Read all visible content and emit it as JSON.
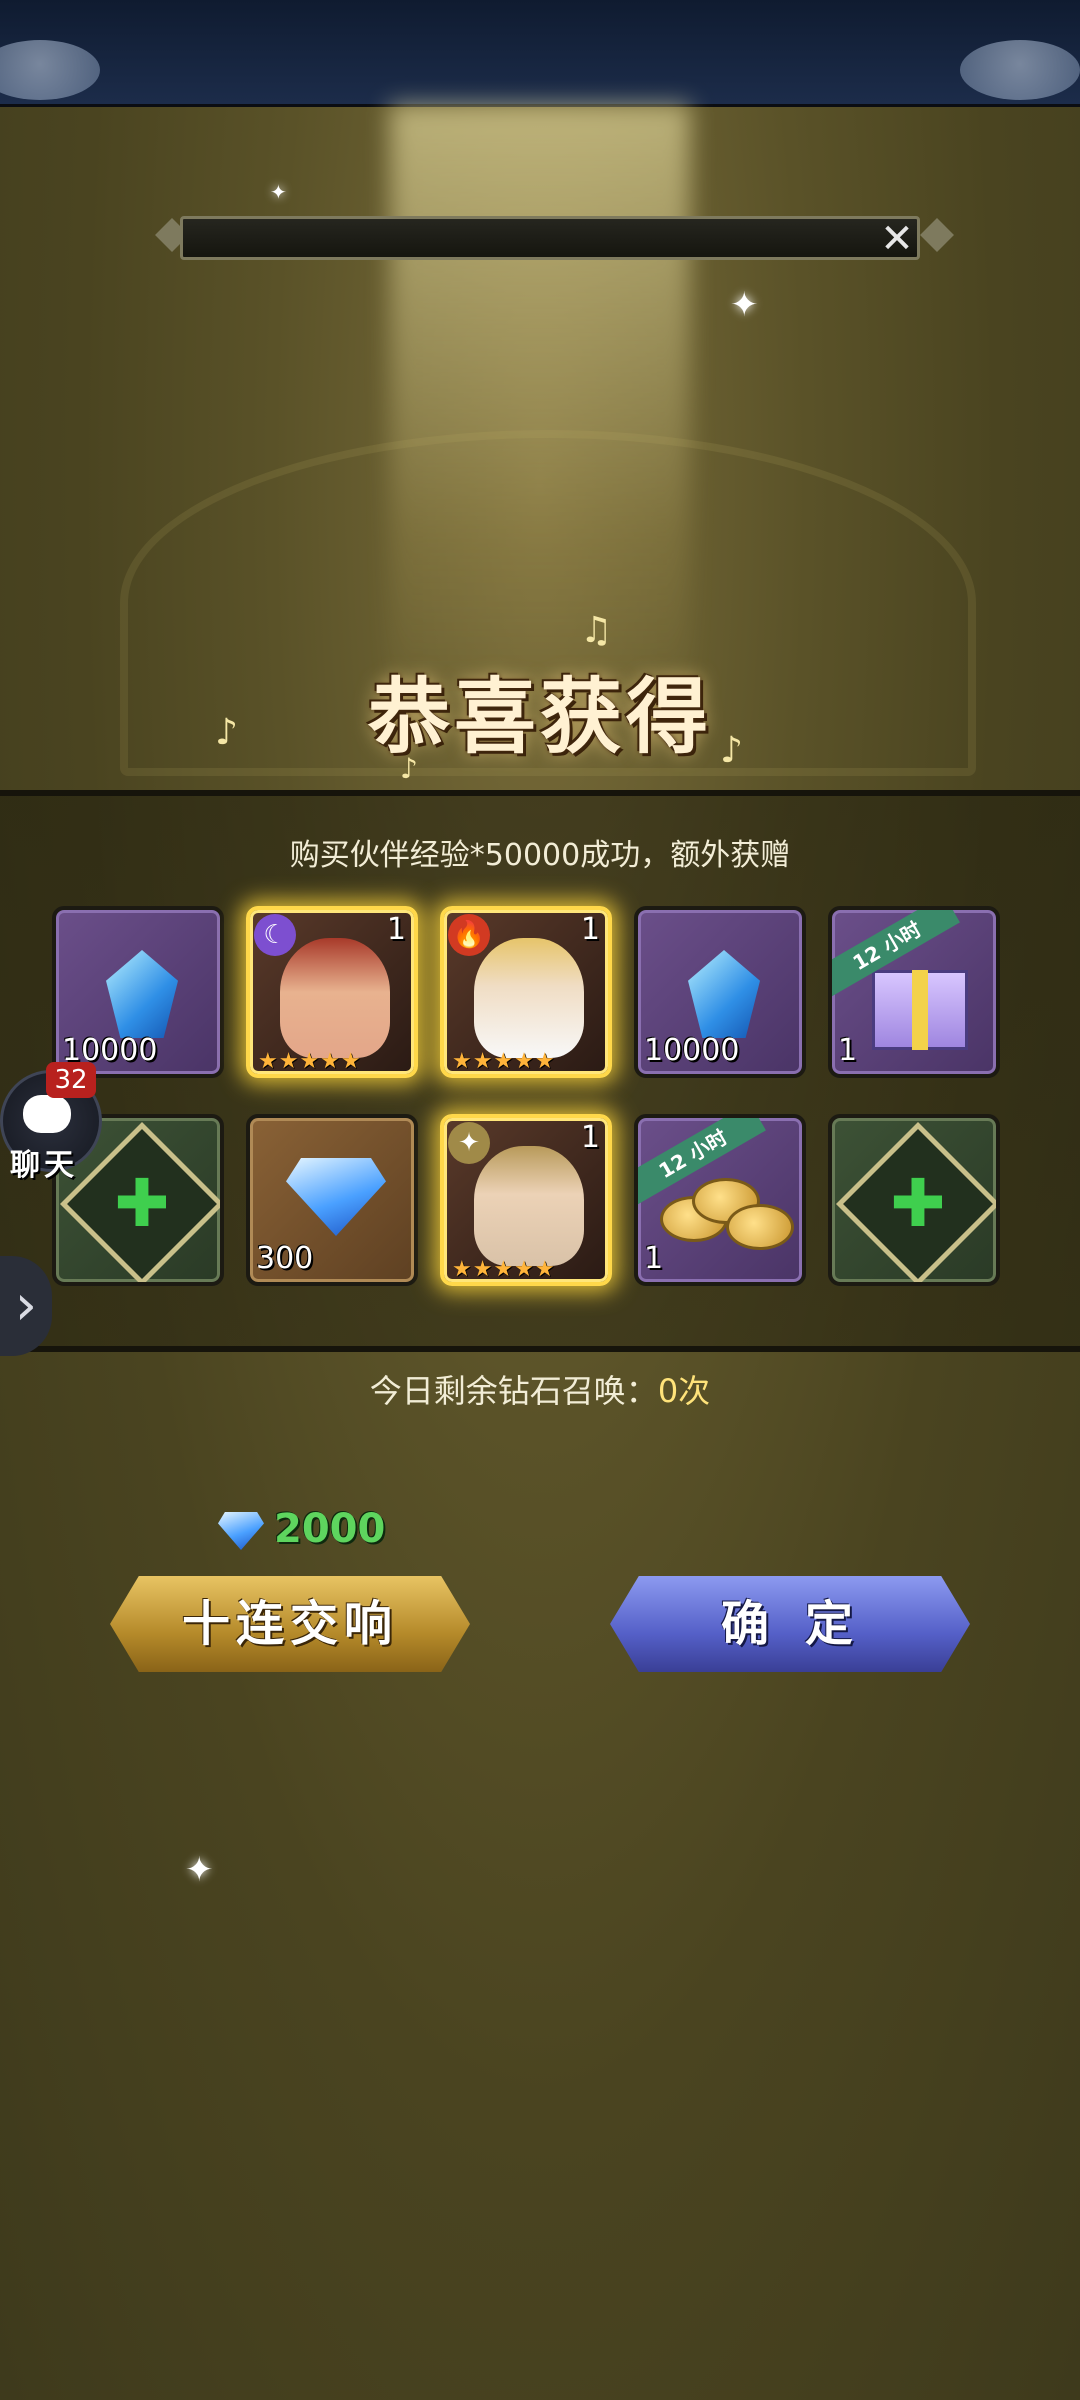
{
  "header": {
    "title_bar_text": ""
  },
  "banner": {
    "title": "恭喜获得"
  },
  "purchase": {
    "message": "购买伙伴经验*50000成功，额外获赠"
  },
  "rewards": [
    {
      "kind": "exp_crystal",
      "qty": "10000",
      "style": "purple"
    },
    {
      "kind": "hero_red_hair",
      "qty": "1",
      "style": "hero",
      "badge_icon": "moon-icon",
      "stars": "★★★★★"
    },
    {
      "kind": "hero_old_king",
      "qty": "1",
      "style": "hero",
      "badge_icon": "fire-icon",
      "stars": "★★★★★"
    },
    {
      "kind": "exp_crystal",
      "qty": "10000",
      "style": "purple"
    },
    {
      "kind": "exp_gift_box",
      "qty": "1",
      "style": "purple",
      "ribbon": "12 小时"
    },
    {
      "kind": "rune",
      "qty": "",
      "style": "green"
    },
    {
      "kind": "diamond",
      "qty": "300",
      "style": "brown"
    },
    {
      "kind": "hero_knight",
      "qty": "1",
      "style": "hero",
      "badge_icon": "star-icon",
      "stars": "★★★★★"
    },
    {
      "kind": "gold_coins",
      "qty": "1",
      "style": "purple",
      "ribbon": "12 小时"
    },
    {
      "kind": "rune",
      "qty": "",
      "style": "green"
    }
  ],
  "chat": {
    "badge": "32",
    "label": "聊天"
  },
  "summon": {
    "label": "今日剩余钻石召唤：",
    "value": "0次"
  },
  "cost": {
    "value": "2000"
  },
  "buttons": {
    "ten_pull": "十连交响",
    "confirm": "确定"
  },
  "colors": {
    "gold_button": "#b58a2a",
    "blue_button": "#5560c8",
    "cost_green": "#5ed55e",
    "accent_yellow": "#ffe37a"
  }
}
